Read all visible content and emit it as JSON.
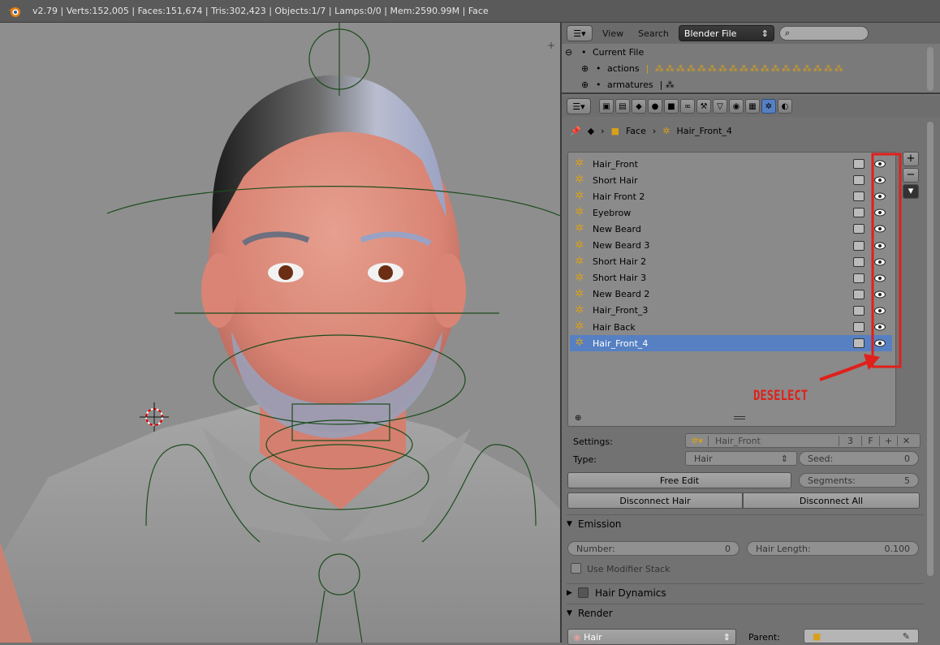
{
  "topbar": {
    "info": "v2.79 | Verts:152,005 | Faces:151,674 | Tris:302,423 | Objects:1/7 | Lamps:0/0 | Mem:2590.99M | Face"
  },
  "outliner": {
    "menu_view": "View",
    "menu_search": "Search",
    "display_mode": "Blender File",
    "rows": [
      {
        "label": "Current File",
        "expand": "⊖"
      },
      {
        "label": "actions",
        "expand": "⊕"
      },
      {
        "label": "armatures",
        "expand": "⊕"
      }
    ]
  },
  "properties": {
    "breadcrumb": {
      "object": "Face",
      "system": "Hair_Front_4"
    },
    "particle_systems": [
      {
        "name": "Hair_Front",
        "selected": false
      },
      {
        "name": "Short Hair",
        "selected": false
      },
      {
        "name": "Hair Front 2",
        "selected": false
      },
      {
        "name": "Eyebrow",
        "selected": false
      },
      {
        "name": "New Beard",
        "selected": false
      },
      {
        "name": "New Beard 3",
        "selected": false
      },
      {
        "name": "Short Hair 2",
        "selected": false
      },
      {
        "name": "Short Hair 3",
        "selected": false
      },
      {
        "name": "New Beard 2",
        "selected": false
      },
      {
        "name": "Hair_Front_3",
        "selected": false
      },
      {
        "name": "Hair Back",
        "selected": false
      },
      {
        "name": "Hair_Front_4",
        "selected": true
      }
    ],
    "annotation": "DESELECT",
    "settings_label": "Settings:",
    "settings_value": "Hair_Front",
    "settings_users": "3",
    "settings_fake": "F",
    "type_label": "Type:",
    "type_value": "Hair",
    "seed_label": "Seed:",
    "seed_value": "0",
    "free_edit": "Free Edit",
    "segments_label": "Segments:",
    "segments_value": "5",
    "disconnect_hair": "Disconnect Hair",
    "disconnect_all": "Disconnect All",
    "emission_header": "Emission",
    "number_label": "Number:",
    "number_value": "0",
    "hair_length_label": "Hair Length:",
    "hair_length_value": "0.100",
    "use_modifier_stack": "Use Modifier Stack",
    "hair_dynamics": "Hair Dynamics",
    "render_header": "Render",
    "render_material": "Hair",
    "parent_label": "Parent:"
  },
  "colors": {
    "selection": "#5680c2",
    "annotation": "#e0201b",
    "particle_icon": "#d9a01a"
  }
}
